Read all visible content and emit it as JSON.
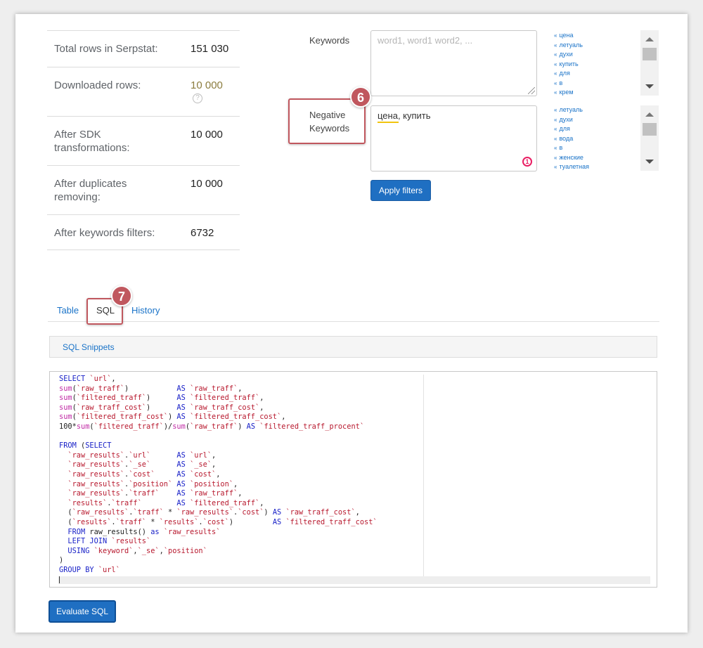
{
  "stats": [
    {
      "label": "Total rows in Serpstat:",
      "value": "151 030"
    },
    {
      "label": "Downloaded rows:",
      "value": "10 000"
    },
    {
      "label": "After SDK transformations:",
      "value": "10 000"
    },
    {
      "label": "After duplicates removing:",
      "value": "10 000"
    },
    {
      "label": "After keywords filters:",
      "value": "6732"
    }
  ],
  "help_icon_glyph": "?",
  "keywords": {
    "label": "Keywords",
    "placeholder": "word1, word1 word2, ...",
    "suggestions": [
      "цена",
      "летуаль",
      "духи",
      "купить",
      "для",
      "в",
      "крем"
    ]
  },
  "negative_keywords": {
    "label_line1": "Negative",
    "label_line2": "Keywords",
    "value": "цена, купить",
    "suggestions": [
      "летуаль",
      "духи",
      "для",
      "вода",
      "в",
      "женские",
      "туалетная"
    ]
  },
  "grammar_badge": "1",
  "suggest_arrows": "«",
  "apply_filters_label": "Apply filters",
  "annotations": {
    "six": "6",
    "seven": "7"
  },
  "tabs": [
    {
      "label": "Table"
    },
    {
      "label": "SQL"
    },
    {
      "label": "History"
    }
  ],
  "sql_snippets_label": "SQL Snippets",
  "sql_code": [
    [
      [
        "kw",
        "SELECT "
      ],
      [
        "str",
        "`url`"
      ],
      [
        "num",
        ","
      ]
    ],
    [
      [
        "fn",
        "sum"
      ],
      [
        "num",
        "("
      ],
      [
        "str",
        "`raw_traff`"
      ],
      [
        "num",
        ")           "
      ],
      [
        "kw",
        "AS "
      ],
      [
        "str",
        "`raw_traff`"
      ],
      [
        "num",
        ","
      ]
    ],
    [
      [
        "fn",
        "sum"
      ],
      [
        "num",
        "("
      ],
      [
        "str",
        "`filtered_traff`"
      ],
      [
        "num",
        ")      "
      ],
      [
        "kw",
        "AS "
      ],
      [
        "str",
        "`filtered_traff`"
      ],
      [
        "num",
        ","
      ]
    ],
    [
      [
        "fn",
        "sum"
      ],
      [
        "num",
        "("
      ],
      [
        "str",
        "`raw_traff_cost`"
      ],
      [
        "num",
        ")      "
      ],
      [
        "kw",
        "AS "
      ],
      [
        "str",
        "`raw_traff_cost`"
      ],
      [
        "num",
        ","
      ]
    ],
    [
      [
        "fn",
        "sum"
      ],
      [
        "num",
        "("
      ],
      [
        "str",
        "`filtered_traff_cost`"
      ],
      [
        "num",
        ") "
      ],
      [
        "kw",
        "AS "
      ],
      [
        "str",
        "`filtered_traff_cost`"
      ],
      [
        "num",
        ","
      ]
    ],
    [
      [
        "num",
        "100*"
      ],
      [
        "fn",
        "sum"
      ],
      [
        "num",
        "("
      ],
      [
        "str",
        "`filtered_traff`"
      ],
      [
        "num",
        ")/"
      ],
      [
        "fn",
        "sum"
      ],
      [
        "num",
        "("
      ],
      [
        "str",
        "`raw_traff`"
      ],
      [
        "num",
        ") "
      ],
      [
        "kw",
        "AS "
      ],
      [
        "str",
        "`filtered_traff_procent`"
      ]
    ],
    [
      [
        "num",
        ""
      ]
    ],
    [
      [
        "kw",
        "FROM "
      ],
      [
        "num",
        "("
      ],
      [
        "kw",
        "SELECT"
      ]
    ],
    [
      [
        "num",
        "  "
      ],
      [
        "str",
        "`raw_results`"
      ],
      [
        "num",
        "."
      ],
      [
        "str",
        "`url`"
      ],
      [
        "num",
        "      "
      ],
      [
        "kw",
        "AS "
      ],
      [
        "str",
        "`url`"
      ],
      [
        "num",
        ","
      ]
    ],
    [
      [
        "num",
        "  "
      ],
      [
        "str",
        "`raw_results`"
      ],
      [
        "num",
        "."
      ],
      [
        "str",
        "`_se`"
      ],
      [
        "num",
        "      "
      ],
      [
        "kw",
        "AS "
      ],
      [
        "str",
        "`_se`"
      ],
      [
        "num",
        ","
      ]
    ],
    [
      [
        "num",
        "  "
      ],
      [
        "str",
        "`raw_results`"
      ],
      [
        "num",
        "."
      ],
      [
        "str",
        "`cost`"
      ],
      [
        "num",
        "     "
      ],
      [
        "kw",
        "AS "
      ],
      [
        "str",
        "`cost`"
      ],
      [
        "num",
        ","
      ]
    ],
    [
      [
        "num",
        "  "
      ],
      [
        "str",
        "`raw_results`"
      ],
      [
        "num",
        "."
      ],
      [
        "str",
        "`position`"
      ],
      [
        "num",
        " "
      ],
      [
        "kw",
        "AS "
      ],
      [
        "str",
        "`position`"
      ],
      [
        "num",
        ","
      ]
    ],
    [
      [
        "num",
        "  "
      ],
      [
        "str",
        "`raw_results`"
      ],
      [
        "num",
        "."
      ],
      [
        "str",
        "`traff`"
      ],
      [
        "num",
        "    "
      ],
      [
        "kw",
        "AS "
      ],
      [
        "str",
        "`raw_traff`"
      ],
      [
        "num",
        ","
      ]
    ],
    [
      [
        "num",
        "  "
      ],
      [
        "str",
        "`results`"
      ],
      [
        "num",
        "."
      ],
      [
        "str",
        "`traff`"
      ],
      [
        "num",
        "        "
      ],
      [
        "kw",
        "AS "
      ],
      [
        "str",
        "`filtered_traff`"
      ],
      [
        "num",
        ","
      ]
    ],
    [
      [
        "num",
        "  ("
      ],
      [
        "str",
        "`raw_results`"
      ],
      [
        "num",
        "."
      ],
      [
        "str",
        "`traff`"
      ],
      [
        "num",
        " * "
      ],
      [
        "str",
        "`raw_results`"
      ],
      [
        "num",
        "."
      ],
      [
        "str",
        "`cost`"
      ],
      [
        "num",
        ") "
      ],
      [
        "kw",
        "AS "
      ],
      [
        "str",
        "`raw_traff_cost`"
      ],
      [
        "num",
        ","
      ]
    ],
    [
      [
        "num",
        "  ("
      ],
      [
        "str",
        "`results`"
      ],
      [
        "num",
        "."
      ],
      [
        "str",
        "`traff`"
      ],
      [
        "num",
        " * "
      ],
      [
        "str",
        "`results`"
      ],
      [
        "num",
        "."
      ],
      [
        "str",
        "`cost`"
      ],
      [
        "num",
        ")         "
      ],
      [
        "kw",
        "AS "
      ],
      [
        "str",
        "`filtered_traff_cost`"
      ]
    ],
    [
      [
        "num",
        "  "
      ],
      [
        "kw",
        "FROM "
      ],
      [
        "num",
        "raw_results() "
      ],
      [
        "kw",
        "as "
      ],
      [
        "str",
        "`raw_results`"
      ]
    ],
    [
      [
        "num",
        "  "
      ],
      [
        "kw",
        "LEFT JOIN "
      ],
      [
        "str",
        "`results`"
      ]
    ],
    [
      [
        "num",
        "  "
      ],
      [
        "kw",
        "USING "
      ],
      [
        "str",
        "`keyword`"
      ],
      [
        "num",
        ","
      ],
      [
        "str",
        "`_se`"
      ],
      [
        "num",
        ","
      ],
      [
        "str",
        "`position`"
      ]
    ],
    [
      [
        "num",
        ")"
      ]
    ],
    [
      [
        "kw",
        "GROUP BY "
      ],
      [
        "str",
        "`url`"
      ]
    ]
  ],
  "evaluate_sql_label": "Evaluate SQL"
}
